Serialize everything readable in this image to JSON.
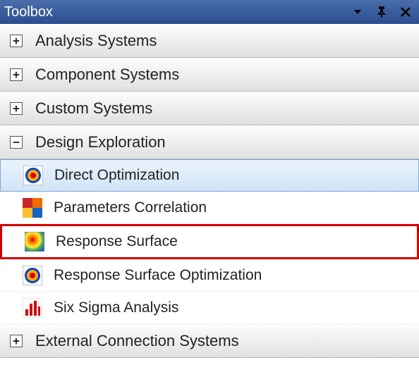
{
  "titlebar": {
    "title": "Toolbox"
  },
  "groups": [
    {
      "id": "analysis-systems",
      "label": "Analysis Systems",
      "expanded": false
    },
    {
      "id": "component-systems",
      "label": "Component Systems",
      "expanded": false
    },
    {
      "id": "custom-systems",
      "label": "Custom Systems",
      "expanded": false
    },
    {
      "id": "design-exploration",
      "label": "Design Exploration",
      "expanded": true
    },
    {
      "id": "external-connection",
      "label": "External Connection Systems",
      "expanded": false
    }
  ],
  "design_exploration_items": [
    {
      "id": "direct-optimization",
      "label": "Direct Optimization",
      "icon": "target",
      "selected": true,
      "highlighted": false
    },
    {
      "id": "parameters-correlation",
      "label": "Parameters Correlation",
      "icon": "heatmap",
      "selected": false,
      "highlighted": false
    },
    {
      "id": "response-surface",
      "label": "Response Surface",
      "icon": "surface",
      "selected": false,
      "highlighted": true
    },
    {
      "id": "response-surface-optimization",
      "label": "Response Surface Optimization",
      "icon": "target",
      "selected": false,
      "highlighted": false
    },
    {
      "id": "six-sigma",
      "label": "Six Sigma Analysis",
      "icon": "bars",
      "selected": false,
      "highlighted": false
    }
  ]
}
